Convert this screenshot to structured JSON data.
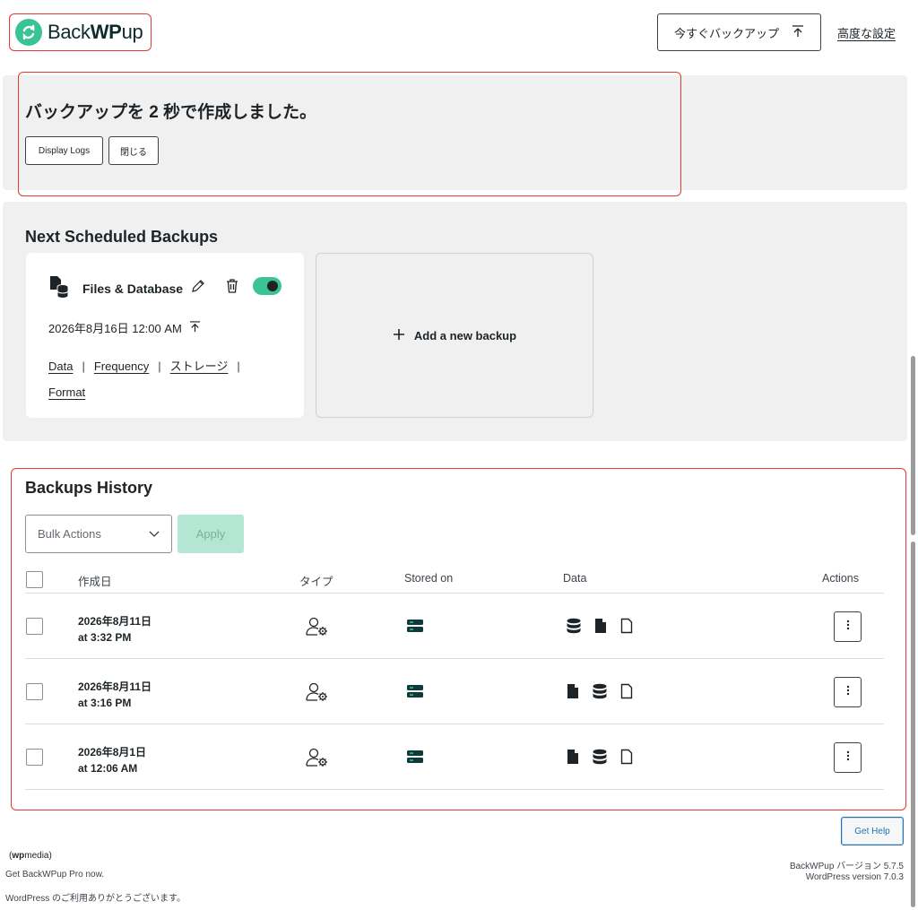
{
  "header": {
    "logo_text_regular": "Back",
    "logo_text_bold": "WP",
    "logo_text_tail": "up",
    "backup_now_label": "今すぐバックアップ",
    "advanced_settings_label": "高度な設定"
  },
  "notice": {
    "message": "バックアップを 2 秒で作成しました。",
    "display_logs_label": "Display Logs",
    "close_label": "閉じる"
  },
  "scheduled": {
    "title": "Next Scheduled Backups",
    "job": {
      "name": "Files & Database",
      "enabled": true,
      "next_run": "2026年8月16日 12:00 AM",
      "links": [
        "Data",
        "Frequency",
        "ストレージ",
        "Format"
      ]
    },
    "add_label": "Add a new backup"
  },
  "history": {
    "title": "Backups History",
    "bulk_actions_placeholder": "Bulk Actions",
    "apply_label": "Apply",
    "columns": {
      "created": "作成日",
      "type": "タイプ",
      "stored_on": "Stored on",
      "data": "Data",
      "actions": "Actions"
    },
    "rows": [
      {
        "date": "2026年8月11日",
        "time": "at 3:32 PM",
        "data_icons": [
          "database-icon",
          "file-filled-icon",
          "file-outline-icon"
        ]
      },
      {
        "date": "2026年8月11日",
        "time": "at 3:16 PM",
        "data_icons": [
          "file-filled-icon",
          "database-icon",
          "file-outline-icon"
        ]
      },
      {
        "date": "2026年8月1日",
        "time": "at 12:06 AM",
        "data_icons": [
          "file-filled-icon",
          "database-icon",
          "file-outline-icon"
        ]
      }
    ]
  },
  "footer": {
    "get_help_label": "Get Help",
    "brand_bold": "wp",
    "brand_regular": "media",
    "get_pro": "Get BackWPup Pro now.",
    "thanks": "WordPress のご利用ありがとうございます。",
    "plugin_version": "BackWPup バージョン 5.7.5",
    "wp_version": "WordPress version 7.0.3"
  },
  "colors": {
    "brand_green": "#3ac495",
    "highlight_red": "#e53935",
    "panel_gray": "#f0f0f1",
    "link_blue": "#2271b1"
  }
}
